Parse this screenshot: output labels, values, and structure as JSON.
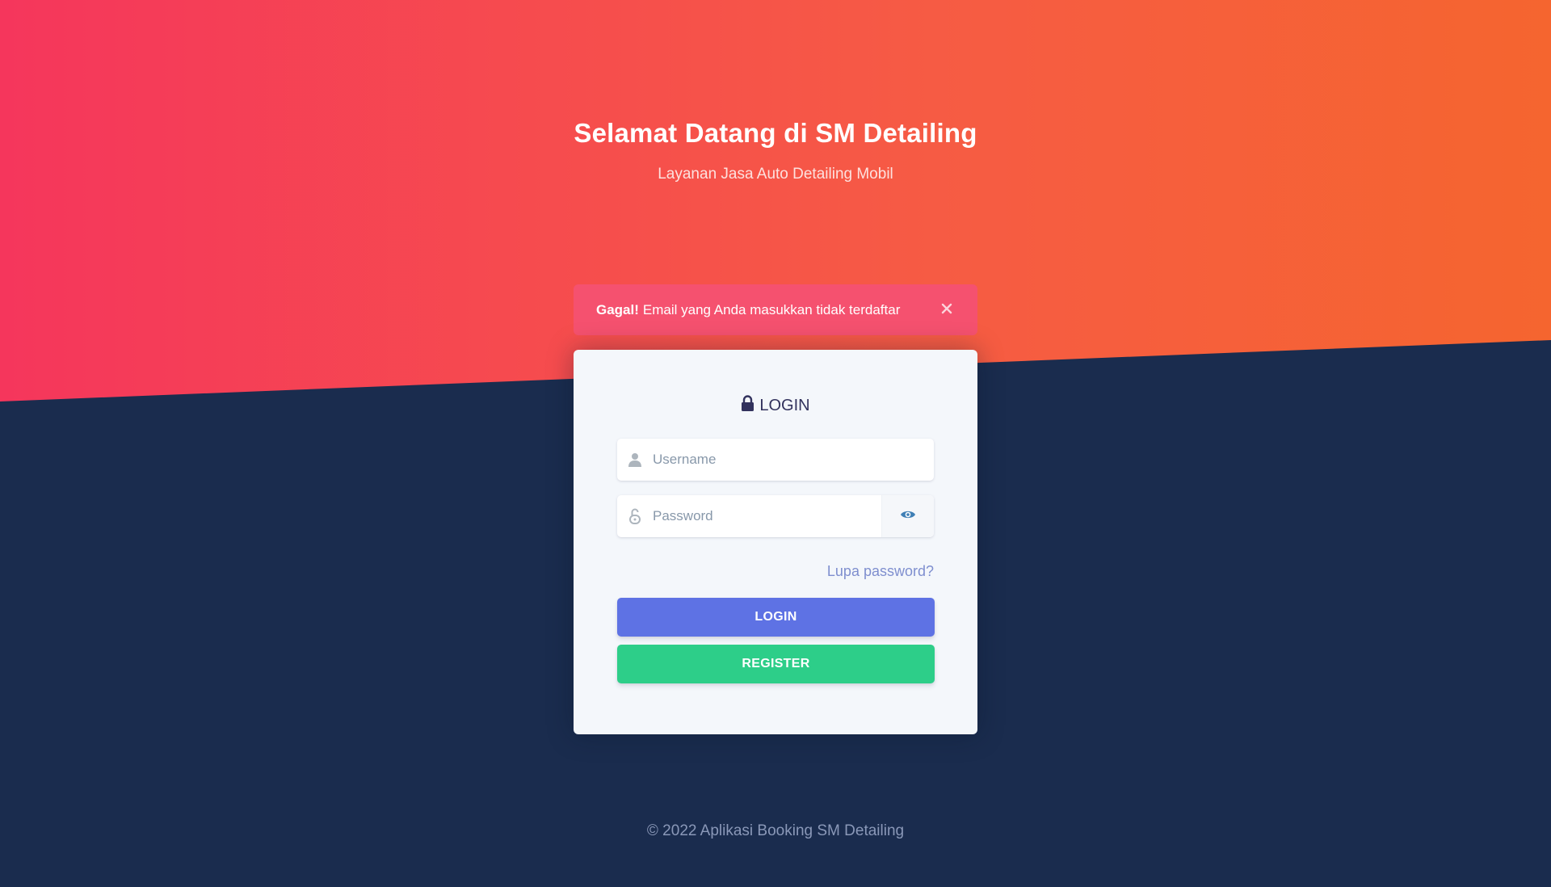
{
  "hero": {
    "title": "Selamat Datang di SM Detailing",
    "subtitle": "Layanan Jasa Auto Detailing Mobil"
  },
  "alert": {
    "strong": "Gagal!",
    "message": "Email yang Anda masukkan tidak terdaftar",
    "close_icon": "close-icon"
  },
  "login_card": {
    "title": "LOGIN",
    "title_icon": "lock-icon",
    "username": {
      "value": "",
      "placeholder": "Username",
      "icon": "user-icon"
    },
    "password": {
      "value": "",
      "placeholder": "Password",
      "icon": "unlock-icon",
      "toggle_icon": "eye-icon"
    },
    "forgot_label": "Lupa password?",
    "login_label": "LOGIN",
    "register_label": "REGISTER"
  },
  "footer": {
    "copyright": "© 2022 Aplikasi Booking SM Detailing"
  },
  "colors": {
    "hero_gradient_start": "#f5365c",
    "hero_gradient_end": "#f5652f",
    "background": "#1a2c4e",
    "alert": "#f5516f",
    "login_button": "#5e72e4",
    "register_button": "#2dce89",
    "link": "#7f8fcf"
  }
}
